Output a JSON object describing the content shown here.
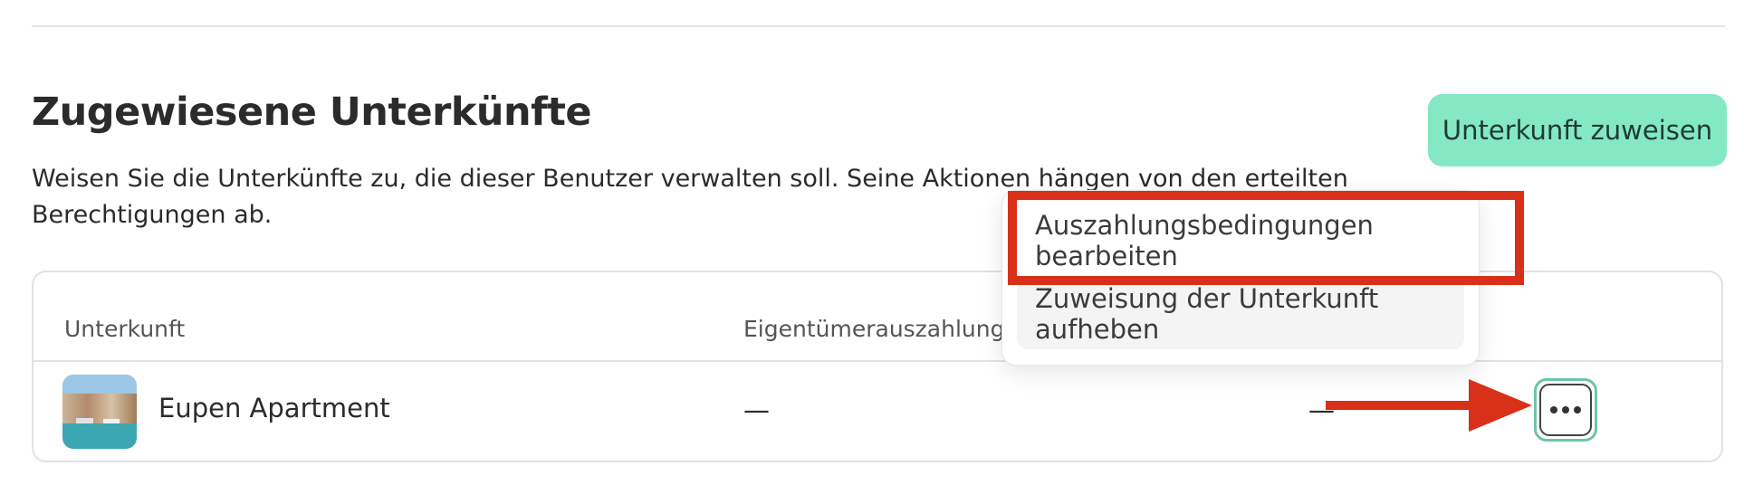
{
  "section": {
    "title": "Zugewiesene Unterkünfte",
    "description": "Weisen Sie die Unterkünfte zu, die dieser Benutzer verwalten soll. Seine Aktionen hängen von den erteilten Berechtigungen ab.",
    "assign_button": "Unterkunft zuweisen"
  },
  "table": {
    "headers": {
      "property": "Unterkunft",
      "payout": "Eigentümerauszahlung"
    },
    "rows": [
      {
        "name": "Eupen Apartment",
        "payout": "—",
        "third": "—"
      }
    ]
  },
  "menu": {
    "items": [
      "Auszahlungsbedingungen bearbeiten",
      "Zuweisung der Unterkunft aufheben"
    ]
  },
  "annotation": {
    "color": "#d9301a"
  },
  "icons": [
    "more-horizontal-icon",
    "property-thumbnail",
    "arrow-right-icon"
  ],
  "colors": {
    "accent_button": "#84e8c5",
    "focus_border": "#6cc5a9"
  }
}
